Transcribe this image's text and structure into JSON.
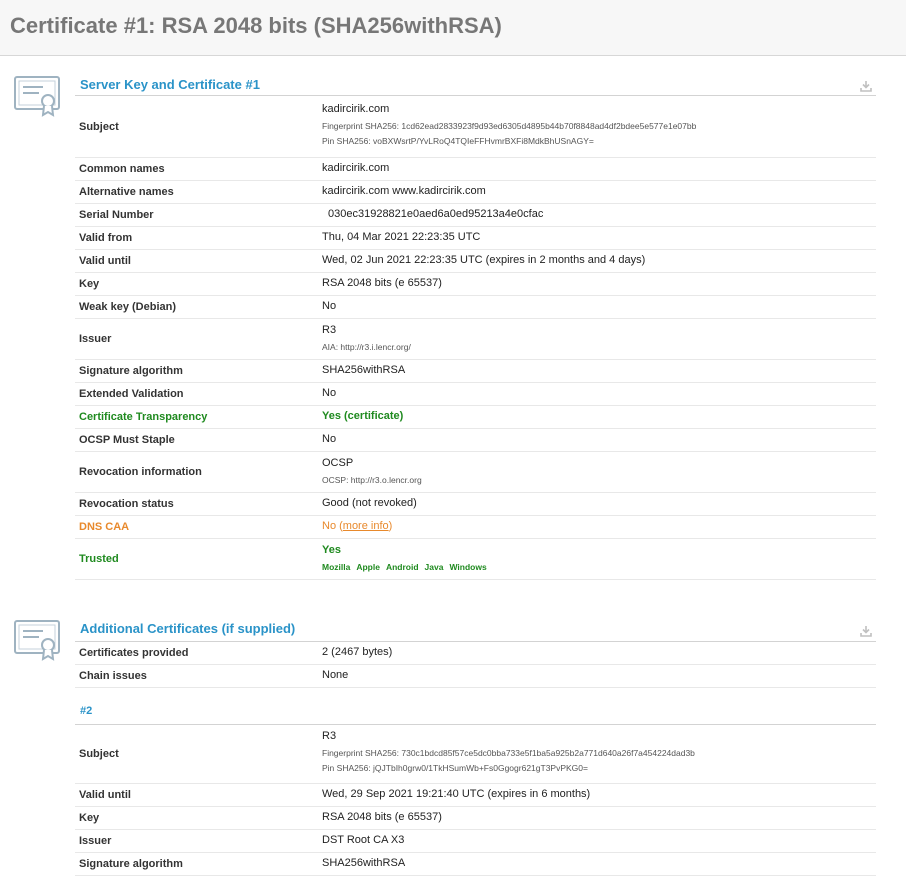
{
  "page_title": "Certificate #1: RSA 2048 bits (SHA256withRSA)",
  "colors": {
    "accent": "#2a93c8",
    "good": "#1f8a1f",
    "warn": "#e8892c"
  },
  "server_section": {
    "title": "Server Key and Certificate #1",
    "icon": "certificate-icon",
    "download_icon": "download-icon",
    "rows": {
      "subject": {
        "label": "Subject",
        "value": "kadircirik.com",
        "fingerprint": "Fingerprint SHA256: 1cd62ead2833923f9d93ed6305d4895b44b70f8848ad4df2bdee5e577e1e07bb",
        "pin": "Pin SHA256: voBXWsrtP/YvLRoQ4TQIeFFHvmrBXFi8MdkBhUSnAGY="
      },
      "common_names": {
        "label": "Common names",
        "value": "kadircirik.com"
      },
      "alt_names": {
        "label": "Alternative names",
        "value": "kadircirik.com www.kadircirik.com"
      },
      "serial": {
        "label": "Serial Number",
        "value": "030ec31928821e0aed6a0ed95213a4e0cfac"
      },
      "valid_from": {
        "label": "Valid from",
        "value": "Thu, 04 Mar 2021 22:23:35 UTC"
      },
      "valid_until": {
        "label": "Valid until",
        "value": "Wed, 02 Jun 2021 22:23:35 UTC (expires in 2 months and 4 days)"
      },
      "key": {
        "label": "Key",
        "value": "RSA 2048 bits (e 65537)"
      },
      "weak_key": {
        "label": "Weak key (Debian)",
        "value": "No"
      },
      "issuer": {
        "label": "Issuer",
        "value": "R3",
        "aia": "AIA: http://r3.i.lencr.org/"
      },
      "sig_alg": {
        "label": "Signature algorithm",
        "value": "SHA256withRSA"
      },
      "ev": {
        "label": "Extended Validation",
        "value": "No"
      },
      "ct": {
        "label": "Certificate Transparency",
        "value": "Yes (certificate)"
      },
      "ocsp_staple": {
        "label": "OCSP Must Staple",
        "value": "No"
      },
      "revocation_info": {
        "label": "Revocation information",
        "value": "OCSP",
        "ocsp": "OCSP: http://r3.o.lencr.org"
      },
      "revocation_status": {
        "label": "Revocation status",
        "value": "Good (not revoked)"
      },
      "dns_caa": {
        "label": "DNS CAA",
        "value": "No (",
        "link": "more info",
        "close": ")"
      },
      "trusted": {
        "label": "Trusted",
        "value": "Yes",
        "stores": [
          "Mozilla",
          "Apple",
          "Android",
          "Java",
          "Windows"
        ]
      }
    }
  },
  "additional_section": {
    "title": "Additional Certificates (if supplied)",
    "icon": "certificate-icon",
    "download_icon": "download-icon",
    "rows": {
      "provided": {
        "label": "Certificates provided",
        "value": "2 (2467 bytes)"
      },
      "chain": {
        "label": "Chain issues",
        "value": "None"
      }
    },
    "cert2": {
      "heading": "#2",
      "rows": {
        "subject": {
          "label": "Subject",
          "value": "R3",
          "fingerprint": "Fingerprint SHA256: 730c1bdcd85f57ce5dc0bba733e5f1ba5a925b2a771d640a26f7a454224dad3b",
          "pin": "Pin SHA256: jQJTbIh0grw0/1TkHSumWb+Fs0Ggogr621gT3PvPKG0="
        },
        "valid_until": {
          "label": "Valid until",
          "value": "Wed, 29 Sep 2021 19:21:40 UTC (expires in 6 months)"
        },
        "key": {
          "label": "Key",
          "value": "RSA 2048 bits (e 65537)"
        },
        "issuer": {
          "label": "Issuer",
          "value": "DST Root CA X3"
        },
        "sig_alg": {
          "label": "Signature algorithm",
          "value": "SHA256withRSA"
        }
      }
    }
  }
}
